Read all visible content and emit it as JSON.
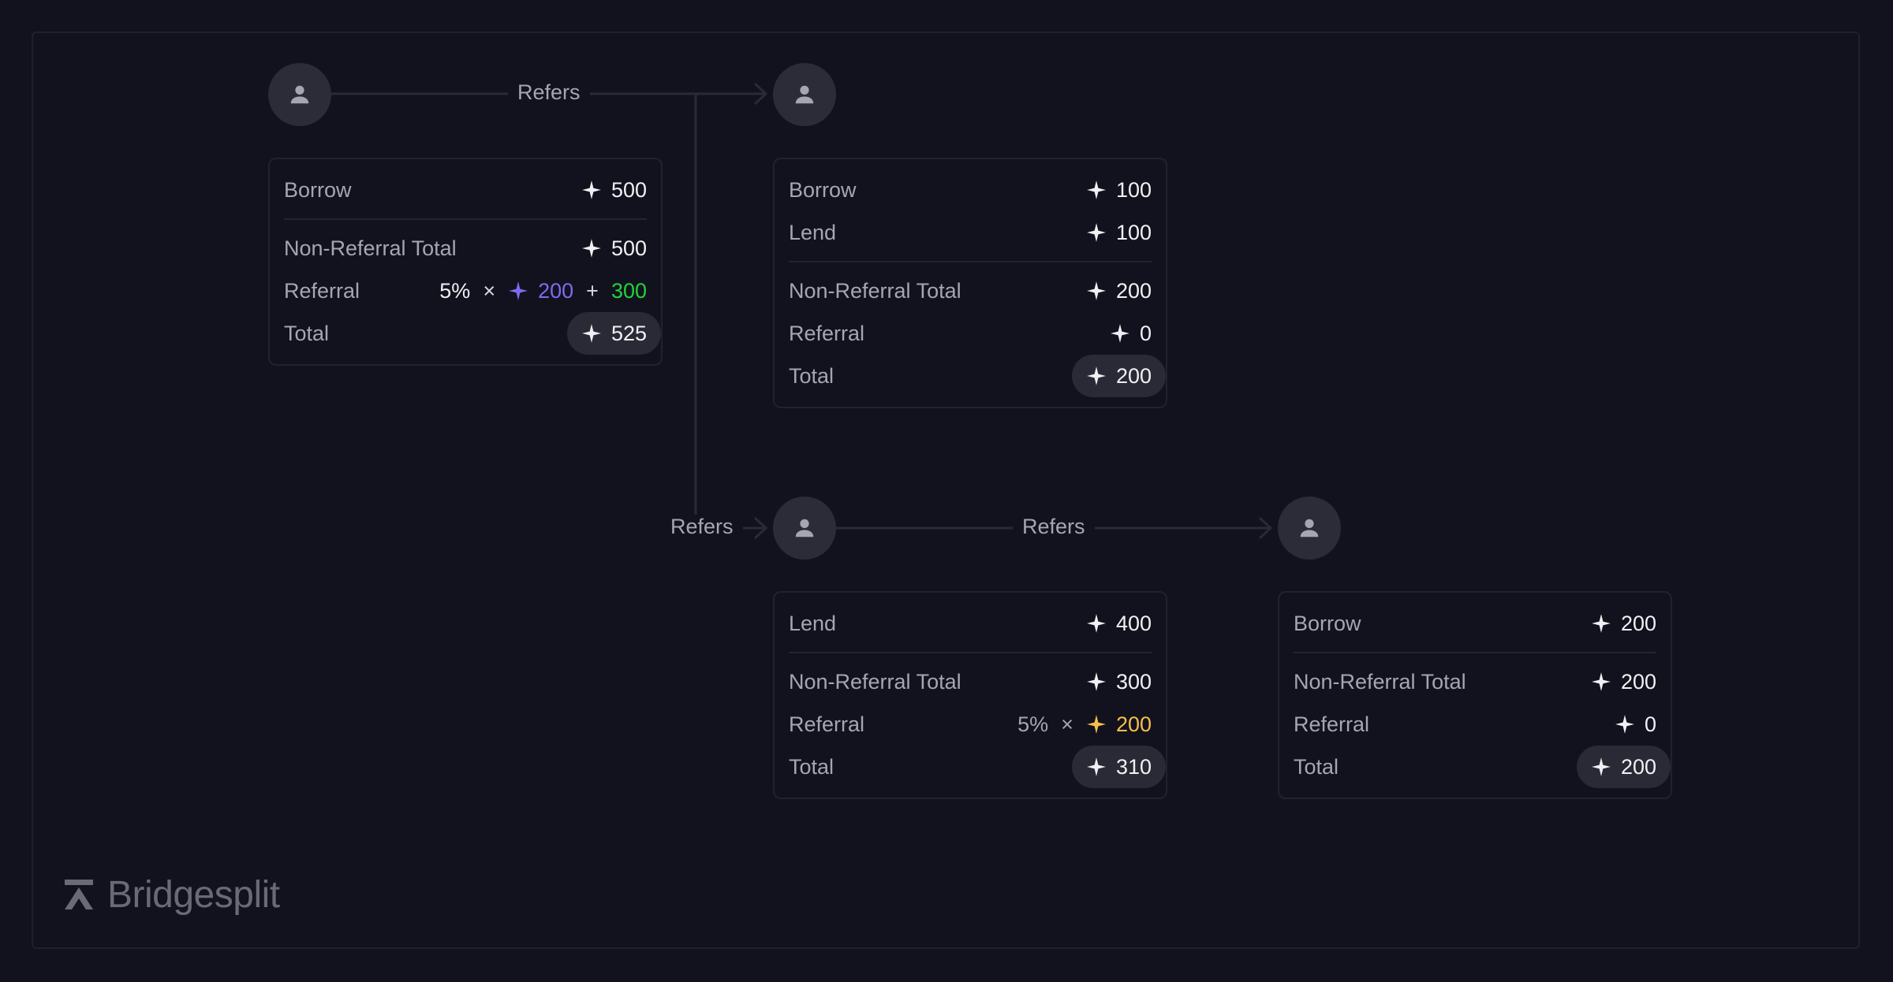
{
  "connectors": {
    "label_top": "Refers",
    "label_mid_left": "Refers",
    "label_mid_right": "Refers"
  },
  "cards": {
    "a": {
      "rows": [
        {
          "label": "Borrow",
          "value": "500"
        },
        {
          "label": "Non-Referral Total",
          "value": "500"
        },
        {
          "label": "Referral",
          "pct": "5%",
          "times": "×",
          "term1": "200",
          "plus": "+",
          "term2": "300"
        },
        {
          "label": "Total",
          "value": "525"
        }
      ]
    },
    "b": {
      "rows": [
        {
          "label": "Borrow",
          "value": "100"
        },
        {
          "label": "Lend",
          "value": "100"
        },
        {
          "label": "Non-Referral Total",
          "value": "200"
        },
        {
          "label": "Referral",
          "value": "0"
        },
        {
          "label": "Total",
          "value": "200"
        }
      ]
    },
    "c": {
      "rows": [
        {
          "label": "Lend",
          "value": "400"
        },
        {
          "label": "Non-Referral Total",
          "value": "300"
        },
        {
          "label": "Referral",
          "pct": "5%",
          "times": "×",
          "term1": "200"
        },
        {
          "label": "Total",
          "value": "310"
        }
      ]
    },
    "d": {
      "rows": [
        {
          "label": "Borrow",
          "value": "200"
        },
        {
          "label": "Non-Referral Total",
          "value": "200"
        },
        {
          "label": "Referral",
          "value": "0"
        },
        {
          "label": "Total",
          "value": "200"
        }
      ]
    }
  },
  "colors": {
    "background": "#12121e",
    "purple": "#7c6cf0",
    "green": "#22d33a",
    "yellow": "#f5c04a",
    "white": "#f0f0f4"
  },
  "icons": {
    "avatar": "user-icon",
    "points": "sparkle-icon",
    "brand": "bridgesplit-logo-icon"
  },
  "brand": {
    "name": "Bridgesplit"
  }
}
